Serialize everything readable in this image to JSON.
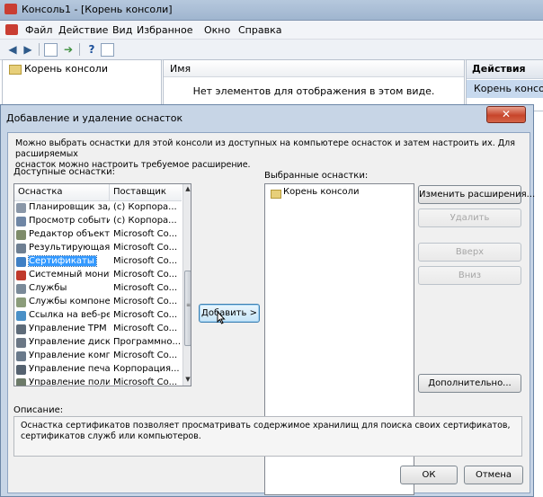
{
  "mmc": {
    "title": "Консоль1 - [Корень консоли]",
    "menu": [
      "Файл",
      "Действие",
      "Вид",
      "Избранное",
      "Окно",
      "Справка"
    ],
    "toolbar_icons": [
      "back-icon",
      "forward-icon",
      "show-hide-tree-icon",
      "export-list-icon",
      "help-icon",
      "show-hide-action-pane-icon"
    ],
    "tree_root": "Корень консоли",
    "list_column_name": "Имя",
    "list_empty_text": "Нет элементов для отображения в этом виде.",
    "actions_title": "Действия",
    "actions_item": "Корень консоли"
  },
  "dialog": {
    "title": "Добавление и удаление оснасток",
    "close_symbol": "✕",
    "intro": "Можно выбрать оснастки для этой консоли из доступных на компьютере оснасток и затем настроить их. Для расширяемых\nоснасток можно настроить требуемое расширение.",
    "available_label": "Доступные оснастки:",
    "selected_label": "Выбранные оснастки:",
    "columns": {
      "name": "Оснастка",
      "vendor": "Поставщик"
    },
    "available": [
      {
        "name": "Планировщик зад...",
        "vendor": "(c) Корпора...",
        "icon": "clock-icon",
        "color": "#8a97a8"
      },
      {
        "name": "Просмотр событий",
        "vendor": "(c) Корпора...",
        "icon": "event-viewer-icon",
        "color": "#6f86a5"
      },
      {
        "name": "Редактор объекто...",
        "vendor": "Microsoft Co...",
        "icon": "gpo-editor-icon",
        "color": "#7e8c6a"
      },
      {
        "name": "Результирующая ...",
        "vendor": "Microsoft Co...",
        "icon": "rsop-icon",
        "color": "#6e7f92"
      },
      {
        "name": "Сертификаты",
        "vendor": "Microsoft Co...",
        "icon": "certificates-icon",
        "color": "#3f7fc4"
      },
      {
        "name": "Системный монитор",
        "vendor": "Microsoft Co...",
        "icon": "system-monitor-icon",
        "color": "#c0392b"
      },
      {
        "name": "Службы",
        "vendor": "Microsoft Co...",
        "icon": "services-icon",
        "color": "#7a8a99"
      },
      {
        "name": "Службы компонен...",
        "vendor": "Microsoft Co...",
        "icon": "component-services-icon",
        "color": "#8b9c7a"
      },
      {
        "name": "Ссылка на веб-ре...",
        "vendor": "Microsoft Co...",
        "icon": "web-link-icon",
        "color": "#4a90c7"
      },
      {
        "name": "Управление TPM",
        "vendor": "Microsoft Co...",
        "icon": "tpm-icon",
        "color": "#5e6b79"
      },
      {
        "name": "Управление диска...",
        "vendor": "Программно...",
        "icon": "disk-management-icon",
        "color": "#6b7785"
      },
      {
        "name": "Управление комп...",
        "vendor": "Microsoft Co...",
        "icon": "computer-management-icon",
        "color": "#6a7a8b"
      },
      {
        "name": "Управление печат...",
        "vendor": "Корпорация...",
        "icon": "print-management-icon",
        "color": "#556270"
      },
      {
        "name": "Управление полит...",
        "vendor": "Microsoft Co...",
        "icon": "policy-management-icon",
        "color": "#6d7b69"
      }
    ],
    "selected_index": 4,
    "add_button": "Добавить >",
    "selected_root": "Корень консоли",
    "buttons": {
      "edit_extensions": "Изменить расширения...",
      "remove": "Удалить",
      "up": "Вверх",
      "down": "Вниз",
      "advanced": "Дополнительно..."
    },
    "description_label": "Описание:",
    "description_text": "Оснастка сертификатов позволяет просматривать содержимое хранилищ для поиска своих сертификатов, сертификатов служб или компьютеров.",
    "ok": "ОК",
    "cancel": "Отмена"
  }
}
